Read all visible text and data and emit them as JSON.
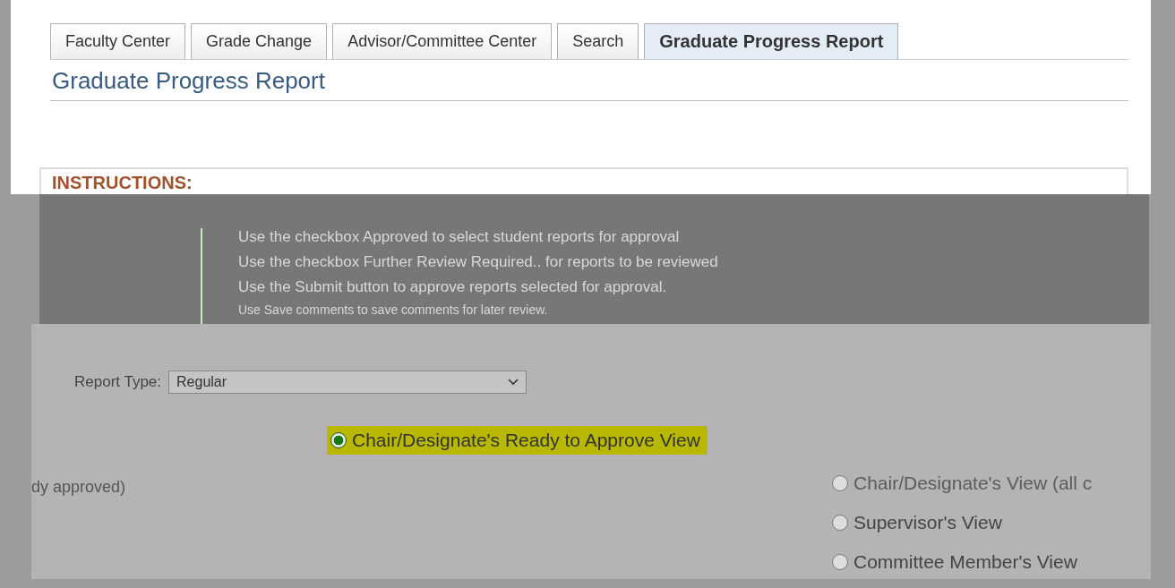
{
  "tabs": [
    {
      "label": "Faculty Center",
      "selected": false
    },
    {
      "label": "Grade Change",
      "selected": false
    },
    {
      "label": "Advisor/Committee Center",
      "selected": false
    },
    {
      "label": "Search",
      "selected": false
    },
    {
      "label": "Graduate Progress Report",
      "selected": true
    }
  ],
  "page_title": "Graduate Progress Report",
  "instructions": {
    "heading": "INSTRUCTIONS:",
    "lines": [
      "Use the checkbox Approved to select student reports for approval",
      "Use the checkbox Further Review Required.. for reports to be reviewed",
      "Use the Submit button to approve reports selected for approval.",
      "Use Save comments to save comments for later review."
    ]
  },
  "report_type": {
    "label": "Report Type:",
    "value": "Regular"
  },
  "center_views": [
    {
      "label": "Chair/Designate's Ready to Approve View",
      "selected": true
    }
  ],
  "left_note": "dy approved)",
  "right_views": [
    {
      "label": "Chair/Designate's View (all c",
      "selected": false
    },
    {
      "label": "Supervisor's View",
      "selected": false
    },
    {
      "label": "Committee Member's View",
      "selected": false
    }
  ]
}
